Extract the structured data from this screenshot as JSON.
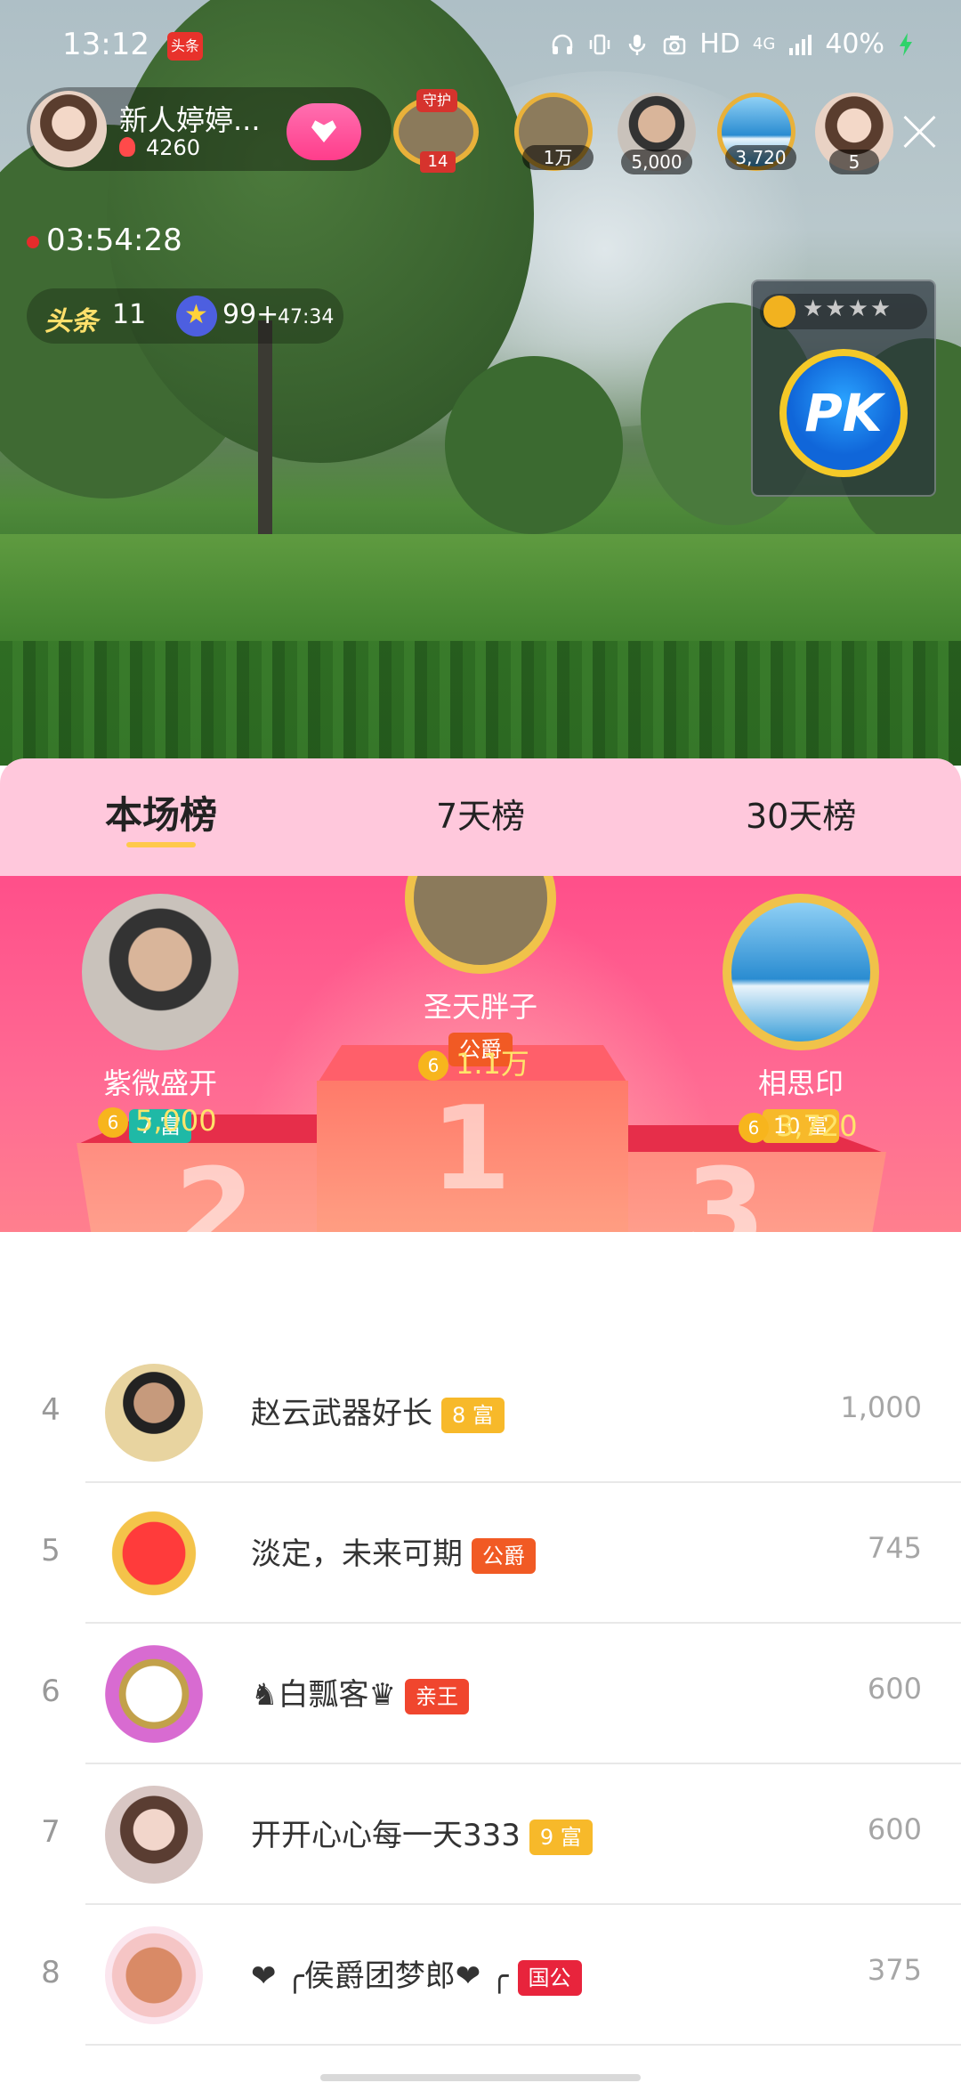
{
  "status_bar": {
    "time": "13:12",
    "app_badge": "头条",
    "network": "HD",
    "signal": "4G",
    "battery": "40%"
  },
  "host": {
    "name": "新人婷婷...",
    "heat": "4260",
    "avatar_icon": "host-avatar"
  },
  "guard": {
    "tag": "守护",
    "count": "14"
  },
  "viewers": [
    {
      "value": "1万"
    },
    {
      "value": "5,000"
    },
    {
      "value": "3,720"
    },
    {
      "value": "5"
    }
  ],
  "live": {
    "timer": "03:54:28",
    "toutiao": "头条",
    "toutiao_count": "11",
    "star_count": "99+",
    "star_time": "47:34"
  },
  "pk": {
    "label": "PK",
    "stars": "★★★★"
  },
  "tabs": [
    "本场榜",
    "7天榜",
    "30天榜"
  ],
  "active_tab": 0,
  "podium": {
    "first": {
      "name": "圣天胖子",
      "badge": "公爵",
      "value": "1.1万",
      "place": "1"
    },
    "second": {
      "name": "紫微盛开",
      "badge": "7 富",
      "value": "5,000",
      "place": "2"
    },
    "third": {
      "name": "相思印",
      "badge": "10 富",
      "value": "3,720",
      "place": "3"
    }
  },
  "list": [
    {
      "rank": "4",
      "name": "赵云武器好长",
      "badge": "8 富",
      "badge_color": "#f7b92a",
      "value": "1,000"
    },
    {
      "rank": "5",
      "name": "淡定，未来可期",
      "badge": "公爵",
      "badge_color": "#f15a24",
      "value": "745"
    },
    {
      "rank": "6",
      "name": "♞白瓢客♛",
      "badge": "亲王",
      "badge_color": "#f0462e",
      "value": "600"
    },
    {
      "rank": "7",
      "name": "开开心心每一天333",
      "badge": "9 富",
      "badge_color": "#f7b92a",
      "value": "600"
    },
    {
      "rank": "8",
      "name": "❤ ╭侯爵团梦郎❤ ╭",
      "badge": "国公",
      "badge_color": "#e8243c",
      "value": "375"
    }
  ],
  "colors": {
    "tab_bg": "#ffc8dc",
    "podium_bg": "#ff4f8a",
    "coin": "#f7b51d",
    "rich_badge_green": "#1fb9a6",
    "rich_badge_yellow": "#f7b92a"
  }
}
